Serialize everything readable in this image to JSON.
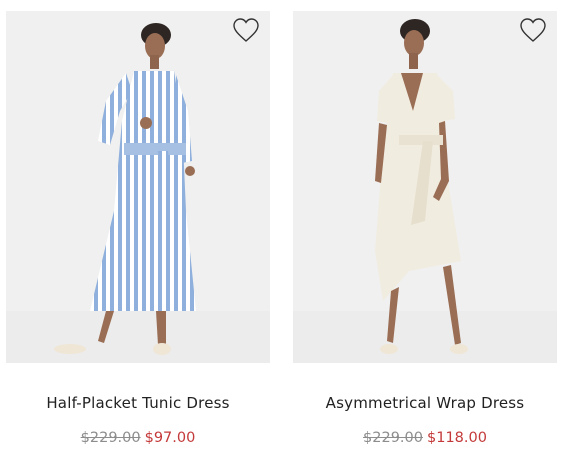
{
  "products": [
    {
      "name": "Half-Placket Tunic Dress",
      "original_price": "$229.00",
      "sale_price": "$97.00",
      "wishlist_icon": "heart-outline-icon",
      "dress_color": "#b7c9e6"
    },
    {
      "name": "Asymmetrical Wrap Dress",
      "original_price": "$229.00",
      "sale_price": "$118.00",
      "wishlist_icon": "heart-outline-icon",
      "dress_color": "#f1ece0"
    }
  ],
  "colors": {
    "sale_price": "#c43a3a",
    "original_price": "#8d8d8d",
    "photo_background": "#f0f0f0"
  }
}
